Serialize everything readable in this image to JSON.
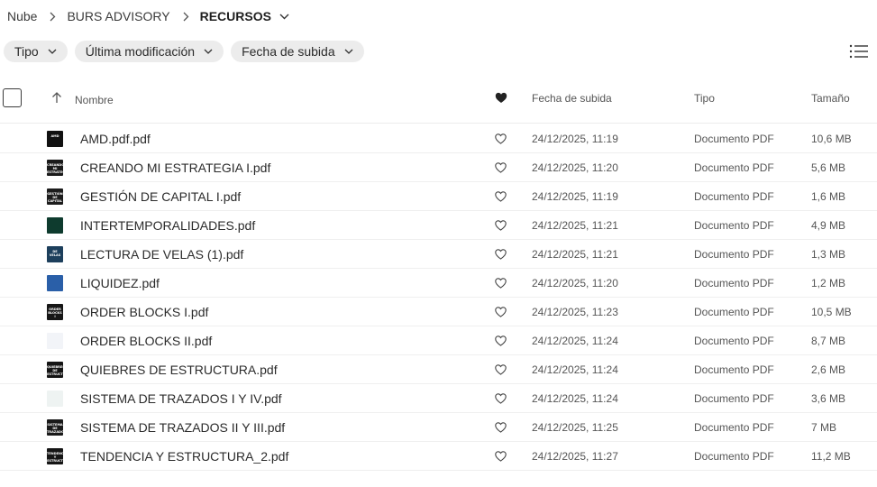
{
  "breadcrumb": {
    "items": [
      "Nube",
      "BURS ADVISORY"
    ],
    "current": "RECURSOS"
  },
  "filters": [
    "Tipo",
    "Última modificación",
    "Fecha de subida"
  ],
  "table": {
    "headers": {
      "name": "Nombre",
      "uploaded": "Fecha de subida",
      "type": "Tipo",
      "size": "Tamaño"
    },
    "rows": [
      {
        "name": "AMD.pdf.pdf",
        "uploaded": "24/12/2025, 11:19",
        "type": "Documento PDF",
        "size": "10,6 MB",
        "thumb_color": "#111111",
        "thumb_label": "AMD"
      },
      {
        "name": "CREANDO MI ESTRATEGIA I.pdf",
        "uploaded": "24/12/2025, 11:20",
        "type": "Documento PDF",
        "size": "5,6 MB",
        "thumb_color": "#1a1a1a",
        "thumb_label": "CREANDO MI ESTRATEGIA"
      },
      {
        "name": "GESTIÓN DE CAPITAL I.pdf",
        "uploaded": "24/12/2025, 11:19",
        "type": "Documento PDF",
        "size": "1,6 MB",
        "thumb_color": "#1c1c1c",
        "thumb_label": "GESTIÓN DE CAPITAL"
      },
      {
        "name": "INTERTEMPORALIDADES.pdf",
        "uploaded": "24/12/2025, 11:21",
        "type": "Documento PDF",
        "size": "4,9 MB",
        "thumb_color": "#0e3b2e",
        "thumb_label": ""
      },
      {
        "name": "LECTURA DE VELAS (1).pdf",
        "uploaded": "24/12/2025, 11:21",
        "type": "Documento PDF",
        "size": "1,3 MB",
        "thumb_color": "#1d3f5c",
        "thumb_label": "DE VELAS"
      },
      {
        "name": "LIQUIDEZ.pdf",
        "uploaded": "24/12/2025, 11:20",
        "type": "Documento PDF",
        "size": "1,2 MB",
        "thumb_color": "#2a5fa8",
        "thumb_label": ""
      },
      {
        "name": "ORDER BLOCKS I.pdf",
        "uploaded": "24/12/2025, 11:23",
        "type": "Documento PDF",
        "size": "10,5 MB",
        "thumb_color": "#161616",
        "thumb_label": "ORDER BLOCKS I"
      },
      {
        "name": "ORDER BLOCKS II.pdf",
        "uploaded": "24/12/2025, 11:24",
        "type": "Documento PDF",
        "size": "8,7 MB",
        "thumb_color": "#f2f4f8",
        "thumb_label": ""
      },
      {
        "name": "QUIEBRES DE ESTRUCTURA.pdf",
        "uploaded": "24/12/2025, 11:24",
        "type": "Documento PDF",
        "size": "2,6 MB",
        "thumb_color": "#141414",
        "thumb_label": "QUIEBRES DE ESTRUCT"
      },
      {
        "name": "SISTEMA DE TRAZADOS I Y IV.pdf",
        "uploaded": "24/12/2025, 11:24",
        "type": "Documento PDF",
        "size": "3,6 MB",
        "thumb_color": "#eef3f2",
        "thumb_label": ""
      },
      {
        "name": "SISTEMA DE TRAZADOS II Y III.pdf",
        "uploaded": "24/12/2025, 11:25",
        "type": "Documento PDF",
        "size": "7 MB",
        "thumb_color": "#1a1a1a",
        "thumb_label": "SISTEMA DE TRAZADOS"
      },
      {
        "name": "TENDENCIA Y ESTRUCTURA_2.pdf",
        "uploaded": "24/12/2025, 11:27",
        "type": "Documento PDF",
        "size": "11,2 MB",
        "thumb_color": "#151515",
        "thumb_label": "TENDENCIA Y ESTRUCT"
      }
    ]
  },
  "icons": {
    "breadcrumb_separator": "chevron-right-icon",
    "dropdown": "chevron-down-icon",
    "view_toggle": "list-view-icon",
    "sort": "arrow-up-icon",
    "favorite_header": "heart-filled-icon",
    "favorite_row": "heart-outline-icon"
  }
}
